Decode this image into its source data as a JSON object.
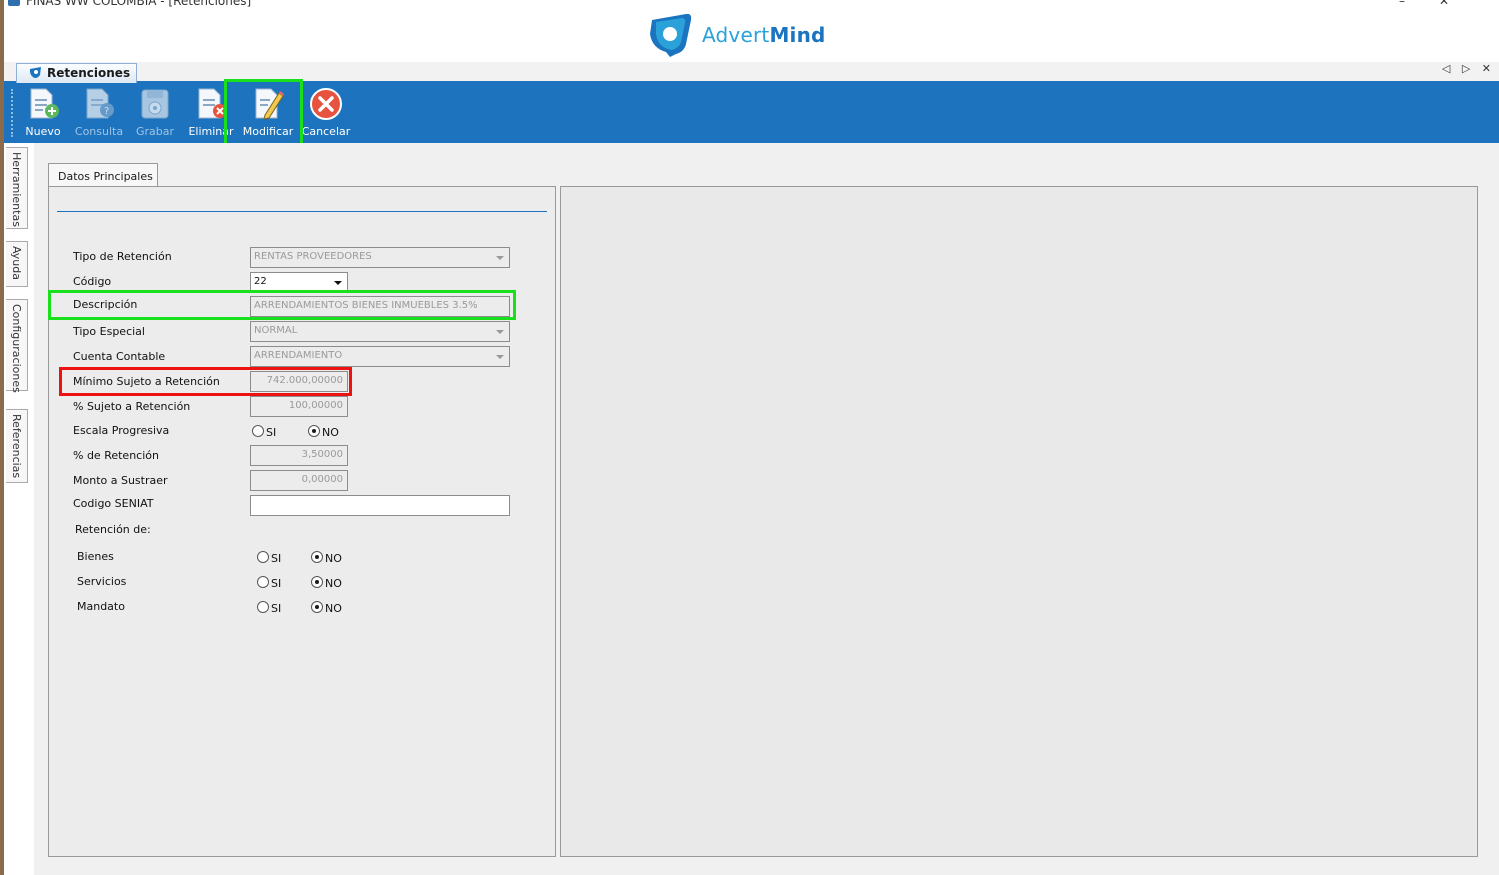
{
  "window": {
    "title": "FINAS WW COLOMBIA - [Retenciones]",
    "controls": [
      "–",
      "✕"
    ]
  },
  "logo": {
    "text_light": "Advert",
    "text_bold": "Mind",
    "brand_color": "#2aa1d8"
  },
  "document_tab": {
    "label": "Retenciones",
    "nav": "◁ ▷ ✕"
  },
  "toolbar": {
    "nuevo": "Nuevo",
    "consulta": "Consulta",
    "grabar": "Grabar",
    "eliminar": "Eliminar",
    "modificar": "Modificar",
    "cancelar": "Cancelar"
  },
  "side_tabs": [
    "Herramientas",
    "Ayuda",
    "Configuraciones",
    "Referencias"
  ],
  "panel_tab": "Datos Principales",
  "form": {
    "tipo_retencion": {
      "label": "Tipo de Retención",
      "value": "RENTAS PROVEEDORES"
    },
    "codigo": {
      "label": "Código",
      "value": "22"
    },
    "descripcion": {
      "label": "Descripción",
      "value": "ARRENDAMIENTOS BIENES INMUEBLES 3.5%"
    },
    "tipo_especial": {
      "label": "Tipo Especial",
      "value": "NORMAL"
    },
    "cuenta_contable": {
      "label": "Cuenta Contable",
      "value": "ARRENDAMIENTO"
    },
    "minimo_sujeto": {
      "label": "Mínimo Sujeto a Retención",
      "value": "742.000,00000"
    },
    "pct_sujeto": {
      "label": "% Sujeto a Retención",
      "value": "100,00000"
    },
    "escala_progresiva": {
      "label": "Escala Progresiva",
      "si": "SI",
      "no": "NO",
      "selected": "NO"
    },
    "pct_retencion": {
      "label": "% de Retención",
      "value": "3,50000"
    },
    "monto_sustraer": {
      "label": "Monto a Sustraer",
      "value": "0,00000"
    },
    "codigo_seniat": {
      "label": "Codigo SENIAT",
      "value": ""
    },
    "retencion_de": {
      "label": "Retención de:"
    },
    "bienes": {
      "label": "Bienes",
      "si": "SI",
      "no": "NO",
      "selected": "NO"
    },
    "servicios": {
      "label": "Servicios",
      "si": "SI",
      "no": "NO",
      "selected": "NO"
    },
    "mandato": {
      "label": "Mandato",
      "si": "SI",
      "no": "NO",
      "selected": "NO"
    }
  },
  "colors": {
    "toolbar_blue": "#1e73be",
    "highlight_green": "#18e01a",
    "highlight_red": "#ee1111"
  }
}
